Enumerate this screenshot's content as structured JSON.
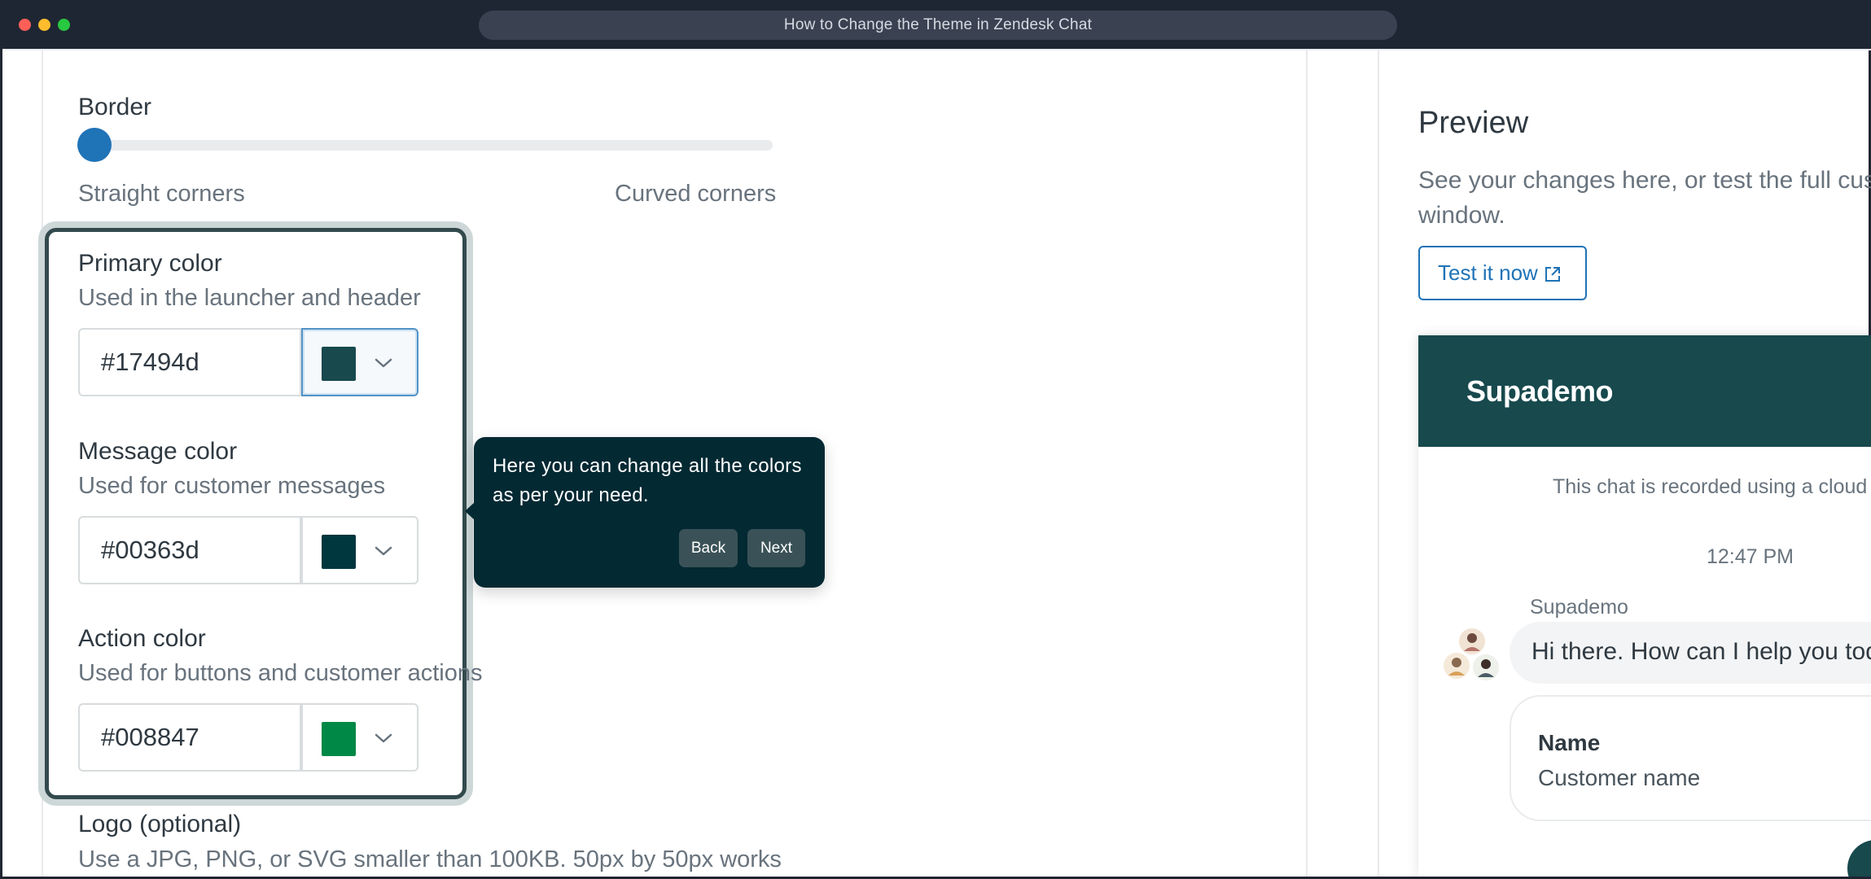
{
  "window": {
    "title": "How to Change the Theme in Zendesk Chat"
  },
  "settings": {
    "border": {
      "label": "Border",
      "value_fraction": 0.0,
      "min_label": "Straight corners",
      "max_label": "Curved corners"
    },
    "primary": {
      "label": "Primary color",
      "description": "Used in the launcher and header",
      "value": "#17494d",
      "swatch": "#17494d"
    },
    "message": {
      "label": "Message color",
      "description": "Used for customer messages",
      "value": "#00363d",
      "swatch": "#00363d"
    },
    "action": {
      "label": "Action color",
      "description": "Used for buttons and customer actions",
      "value": "#008847",
      "swatch": "#008847"
    },
    "logo": {
      "label": "Logo (optional)",
      "description": "Use a JPG, PNG, or SVG smaller than 100KB. 50px by 50px works"
    }
  },
  "tooltip": {
    "text": "Here you can change all the colors as per your need.",
    "back_label": "Back",
    "next_label": "Next"
  },
  "preview": {
    "title": "Preview",
    "description_line1": "See your changes here, or test the full custo",
    "description_line2": "window.",
    "test_button": "Test it now",
    "chat": {
      "brand": "Supademo",
      "notice": "This chat is recorded using a cloud",
      "time": "12:47 PM",
      "sender": "Supademo",
      "greeting": "Hi there. How can I help you toda",
      "form_label": "Name",
      "form_value": "Customer name"
    }
  },
  "colors": {
    "slider_thumb": "#1f73b7",
    "tooltip_bg": "#032933",
    "header_bg": "#17494d"
  }
}
